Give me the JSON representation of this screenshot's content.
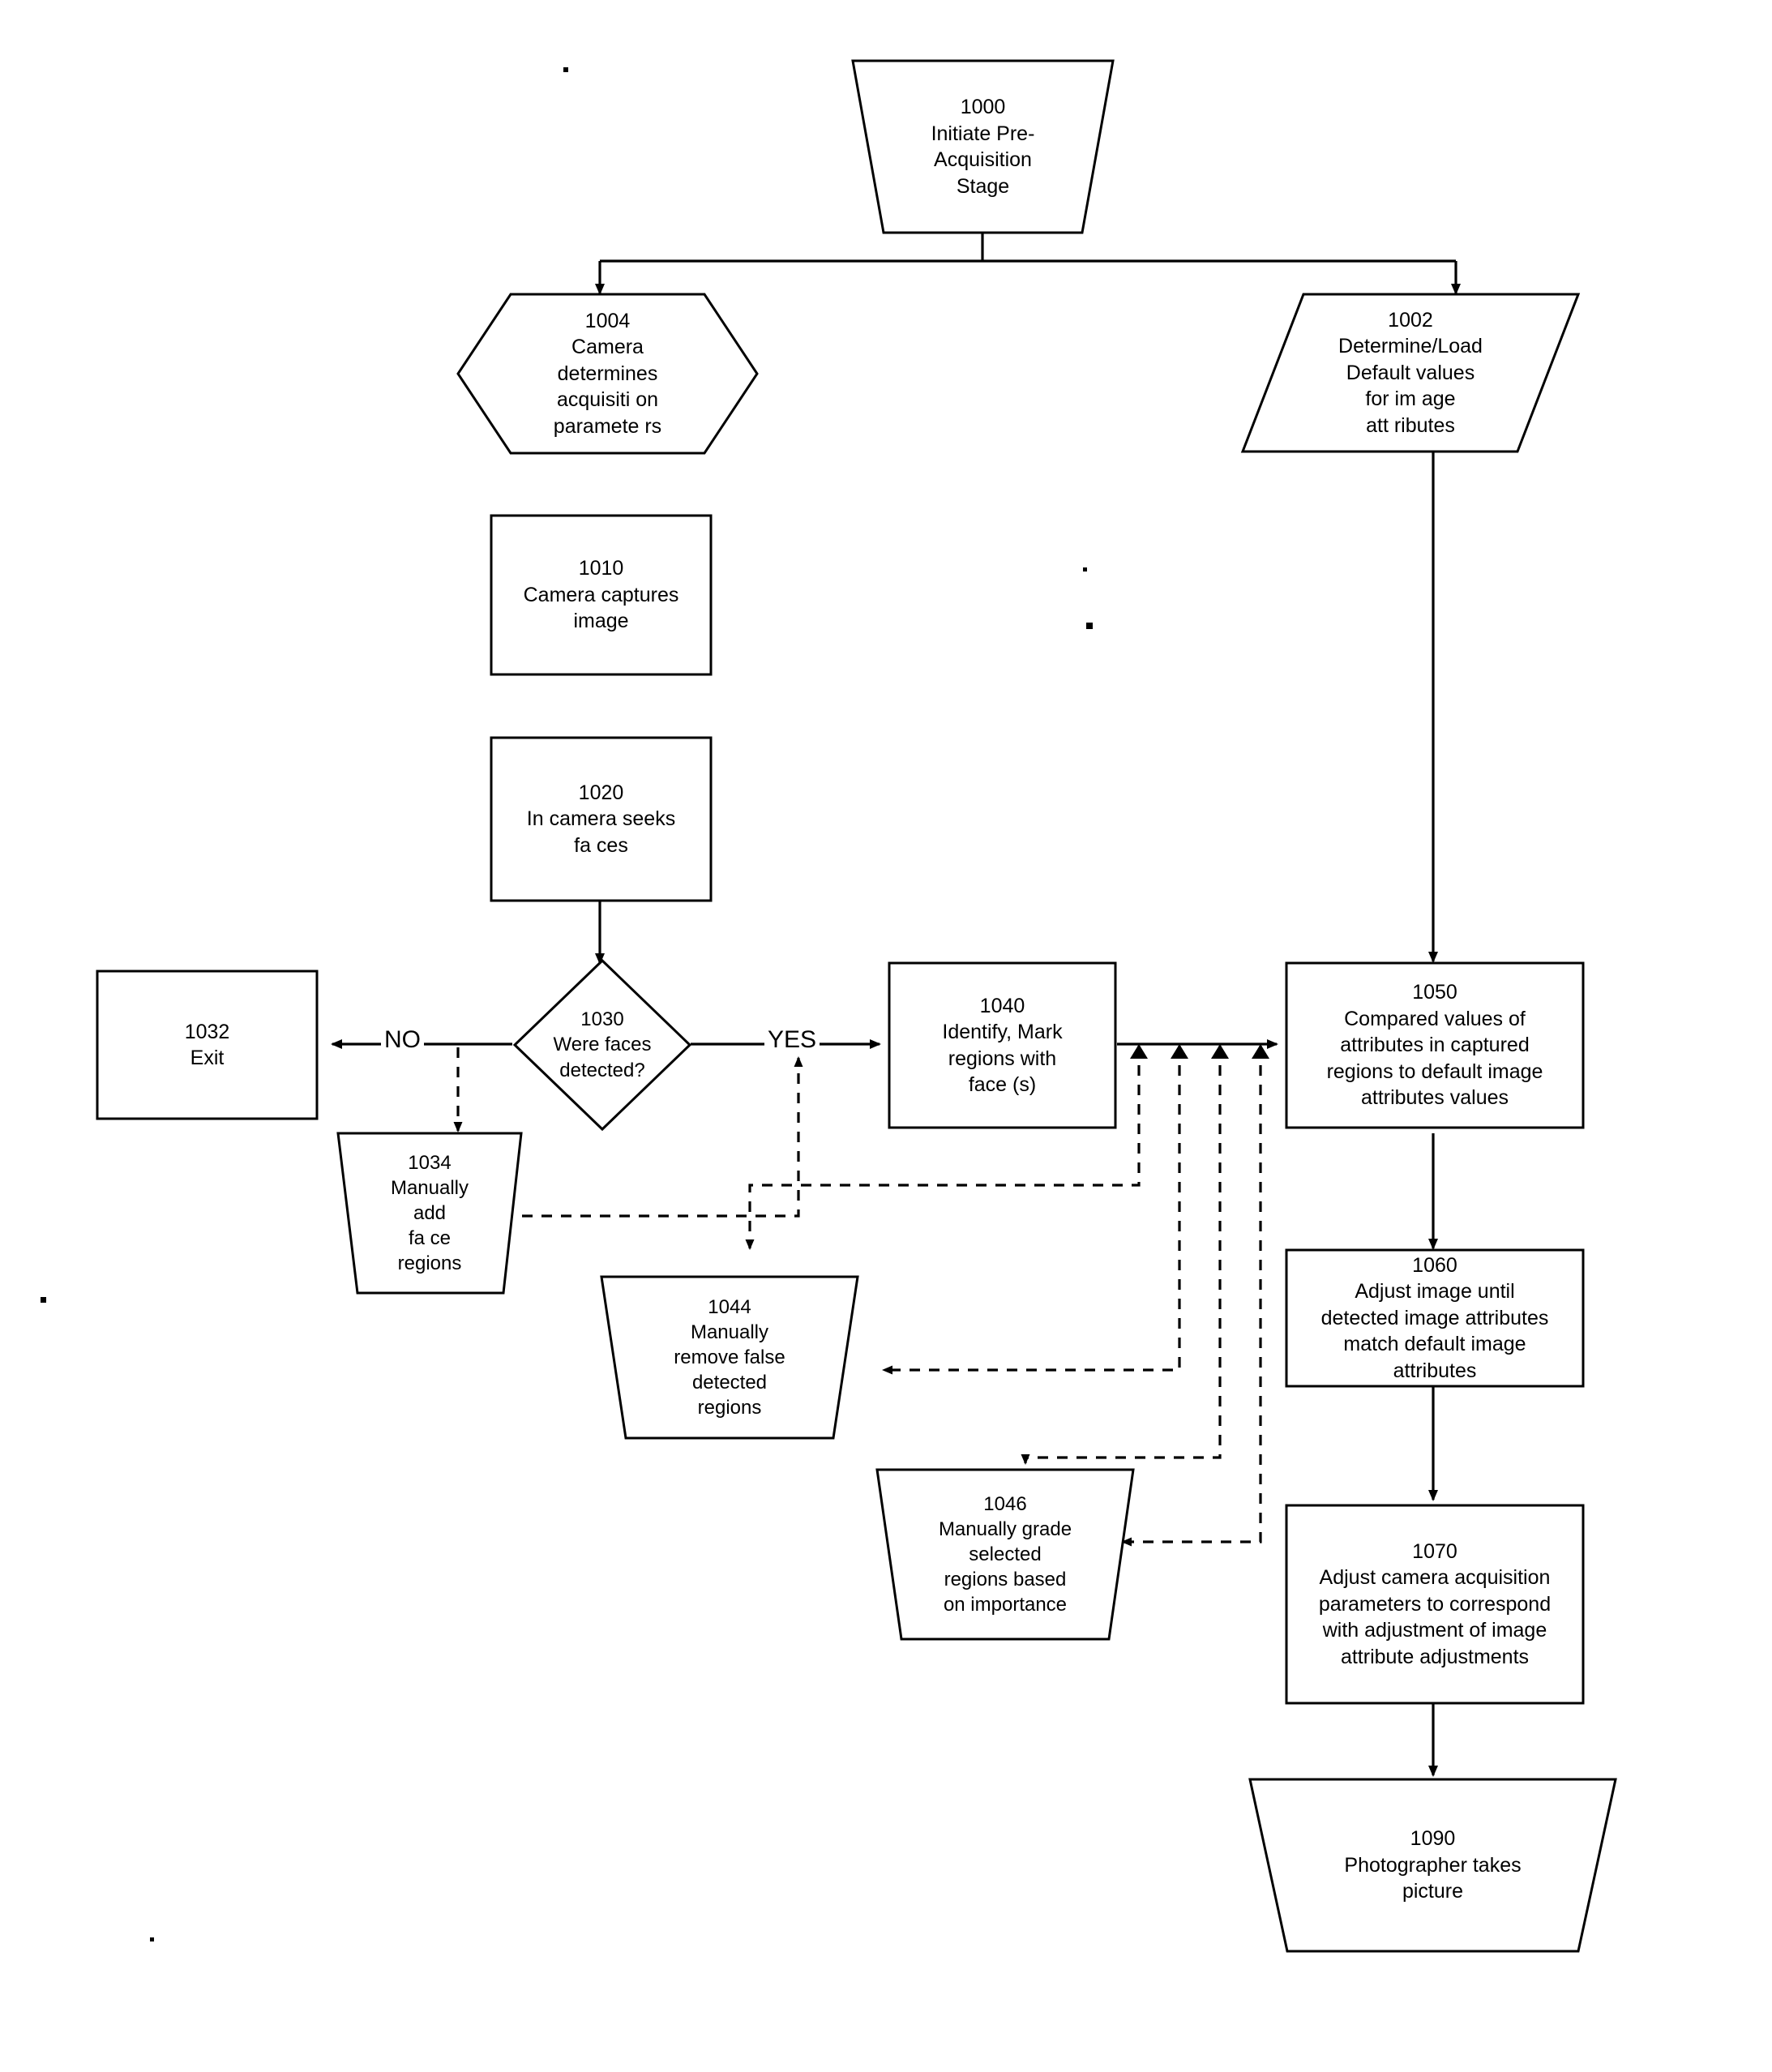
{
  "diagram": {
    "title": "Pre-Acquisition Stage Flowchart",
    "stroke_color": "#000000",
    "fill_color": "#ffffff",
    "background": "#ffffff",
    "edge_labels": {
      "no": "NO",
      "yes": "YES"
    }
  },
  "nodes": {
    "n1000": {
      "id": "1000",
      "text": "1000\nInitiate Pre-\nAcquisition\nStage",
      "shape": "trapezoid-down"
    },
    "n1004": {
      "id": "1004",
      "text": "1004\nCamera\ndetermines\nacquisiti on\nparamete  rs",
      "shape": "hexagon"
    },
    "n1002": {
      "id": "1002",
      "text": "1002\nDetermine/Load\nDefault values\nfor  im age\natt ributes",
      "shape": "parallelogram"
    },
    "n1010": {
      "id": "1010",
      "text": "1010\nCamera captures\nimage",
      "shape": "rect"
    },
    "n1020": {
      "id": "1020",
      "text": "1020\nIn camera seeks\nfa ces",
      "shape": "rect"
    },
    "n1030": {
      "id": "1030",
      "text": "1030\nWere faces\ndetected?",
      "shape": "diamond"
    },
    "n1032": {
      "id": "1032",
      "text": "1032\nExit",
      "shape": "rect"
    },
    "n1034": {
      "id": "1034",
      "text": "1034\nManually\nadd\nfa ce\nregions",
      "shape": "trapezoid-down"
    },
    "n1040": {
      "id": "1040",
      "text": "1040\nIdentify, Mark\nregions with\nface (s)",
      "shape": "rect"
    },
    "n1044": {
      "id": "1044",
      "text": "1044\nManually\nremove false\ndetected\nregions",
      "shape": "trapezoid-down"
    },
    "n1046": {
      "id": "1046",
      "text": "1046\nManually grade\nselected\nregions based\non importance",
      "shape": "trapezoid-down"
    },
    "n1050": {
      "id": "1050",
      "text": "1050\nCompared values of\nattributes in captured\nregions to default image\nattributes values",
      "shape": "rect"
    },
    "n1060": {
      "id": "1060",
      "text": "1060\nAdjust image until\ndetected image attributes\nmatch  default image\nattributes",
      "shape": "rect"
    },
    "n1070": {
      "id": "1070",
      "text": "1070\nAdjust camera acquisition\nparameters to correspond\nwith  adjustment of image\nattribute adjustments",
      "shape": "rect"
    },
    "n1090": {
      "id": "1090",
      "text": "1090\nPhotographer takes\npicture",
      "shape": "trapezoid-down"
    }
  },
  "connections": [
    {
      "from": "1000",
      "to": "1004",
      "style": "solid"
    },
    {
      "from": "1000",
      "to": "1002",
      "style": "solid"
    },
    {
      "from": "1020",
      "to": "1030",
      "style": "solid"
    },
    {
      "from": "1030",
      "to": "1032",
      "style": "solid",
      "label": "NO"
    },
    {
      "from": "1030",
      "to": "1040",
      "style": "solid",
      "label": "YES"
    },
    {
      "from": "1030",
      "to": "1034",
      "style": "dashed"
    },
    {
      "from": "1034",
      "to": "1040-input",
      "style": "dashed"
    },
    {
      "from": "1040",
      "to": "1050",
      "style": "solid"
    },
    {
      "from": "1002",
      "to": "1050",
      "style": "solid"
    },
    {
      "from": "1044",
      "to": "1050-input",
      "style": "dashed"
    },
    {
      "from": "1046",
      "to": "1050-input",
      "style": "dashed"
    },
    {
      "from": "1050-input",
      "to": "1044",
      "style": "dashed"
    },
    {
      "from": "1050-input",
      "to": "1046",
      "style": "dashed"
    },
    {
      "from": "1050",
      "to": "1060",
      "style": "solid"
    },
    {
      "from": "1060",
      "to": "1070",
      "style": "solid"
    },
    {
      "from": "1070",
      "to": "1090",
      "style": "solid"
    }
  ]
}
